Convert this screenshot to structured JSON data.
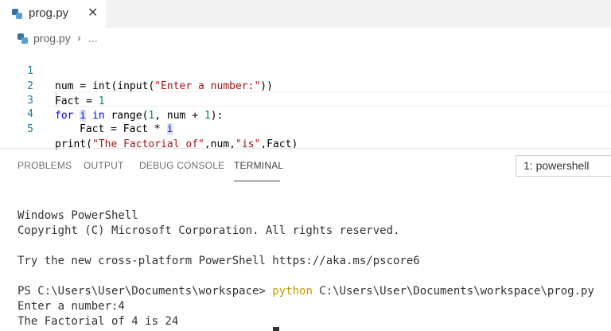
{
  "tab": {
    "label": "prog.py",
    "close_glyph": "✕"
  },
  "breadcrumb": {
    "file": "prog.py",
    "separator": "›",
    "more": "..."
  },
  "editor": {
    "lines": [
      {
        "number": "1"
      },
      {
        "number": "2"
      },
      {
        "number": "3"
      },
      {
        "number": "4"
      },
      {
        "number": "5"
      }
    ]
  },
  "code": {
    "l1_a": "num = int(input(",
    "l1_str": "\"Enter a number:\"",
    "l1_b": "))",
    "l2_a": "Fact = ",
    "l2_num": "1",
    "l3_for": "for",
    "l3_i": "i",
    "l3_in": "in",
    "l3_a": " range(",
    "l3_n1": "1",
    "l3_b": ", num + ",
    "l3_n2": "1",
    "l3_c": "):",
    "l4_a": "Fact = Fact * ",
    "l4_i": "i",
    "l5_a": "print(",
    "l5_s1": "\"The Factorial of\"",
    "l5_b": ",num,",
    "l5_s2": "\"is\"",
    "l5_c": ",Fact)"
  },
  "panel": {
    "tabs": [
      "PROBLEMS",
      "OUTPUT",
      "DEBUG CONSOLE",
      "TERMINAL"
    ],
    "active_tab": "TERMINAL",
    "terminal_select": "1: powershell"
  },
  "terminal": {
    "line1": "Windows PowerShell",
    "line2": "Copyright (C) Microsoft Corporation. All rights reserved.",
    "line3": "Try the new cross-platform PowerShell https://aka.ms/pscore6",
    "prompt": "PS C:\\Users\\User\\Documents\\workspace> ",
    "command": "python",
    "command_arg": " C:\\Users\\User\\Documents\\workspace\\prog.py",
    "output1": "Enter a number:4",
    "output2": "The Factorial of 4 is 24"
  },
  "colors": {
    "keyword": "#0000ff",
    "number": "#098658",
    "string": "#a31515",
    "line_number": "#237893",
    "command": "#c19c00"
  },
  "icons": [
    "python-file-icon",
    "close-icon"
  ]
}
